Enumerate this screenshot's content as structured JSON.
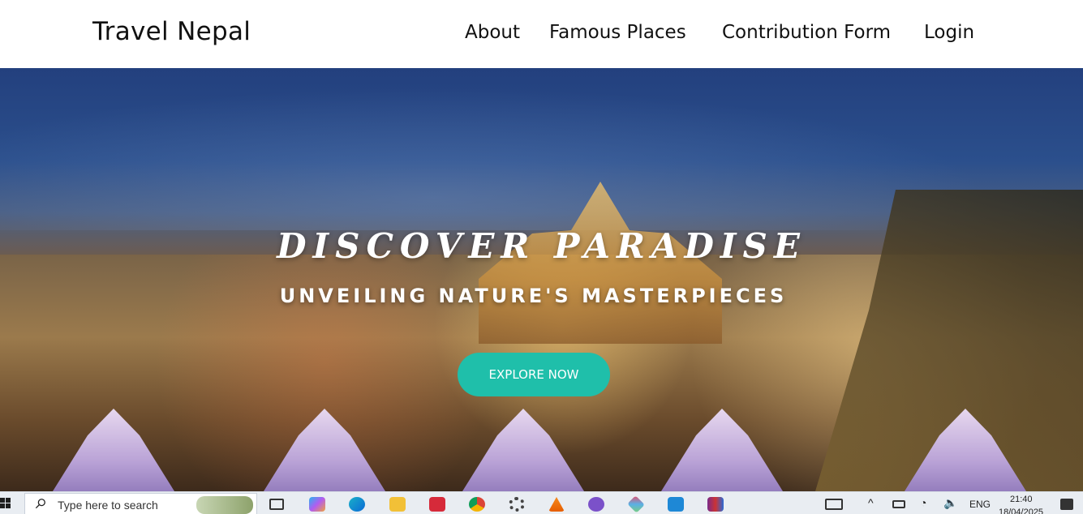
{
  "header": {
    "brand": "Travel Nepal",
    "nav": [
      "About",
      "Famous Places",
      "Contribution Form",
      "Login"
    ]
  },
  "hero": {
    "title": "DISCOVER PARADISE",
    "subtitle": "UNVEILING NATURE'S MASTERPIECES",
    "cta_label": "EXPLORE NOW",
    "accent": "#1fbfaa"
  },
  "taskbar": {
    "search_placeholder": "Type here to search",
    "apps": [
      "task-view-icon",
      "copilot-icon",
      "edge-icon",
      "file-explorer-icon",
      "media-icon",
      "chrome-icon",
      "settings-icon",
      "vlc-icon",
      "viber-icon",
      "app-icon",
      "vscode-icon",
      "winrar-icon"
    ],
    "language": "ENG",
    "time": "21:40",
    "date": "18/04/2025"
  }
}
